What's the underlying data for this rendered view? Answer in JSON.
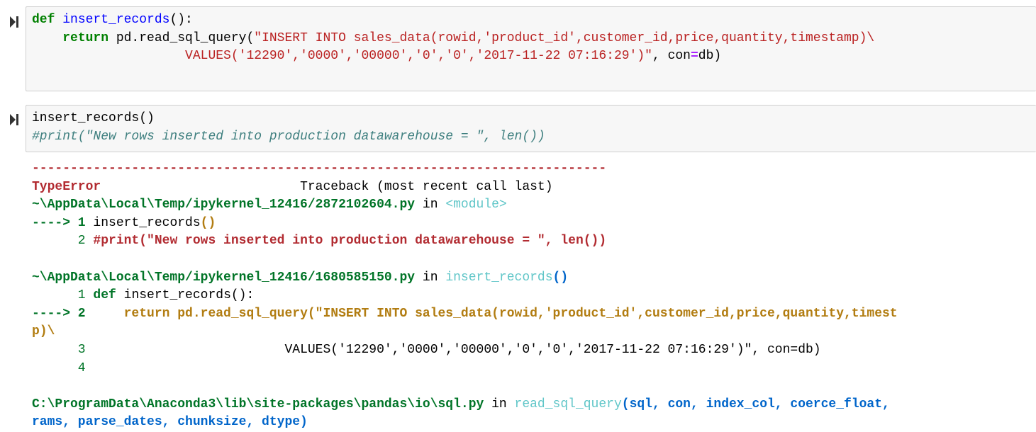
{
  "cell1": {
    "lines": [
      [
        "def",
        " ",
        "insert_records",
        "():"
      ],
      [
        "    ",
        "return",
        " pd.read_sql_query(",
        "\"INSERT INTO sales_data(rowid,'product_id',customer_id,price,quantity,timestamp)\\"
      ],
      [
        "                    ",
        "VALUES('12290','0000','00000','0','0','2017-11-22 07:16:29')\"",
        ", con",
        "=",
        "db)"
      ]
    ]
  },
  "cell2": {
    "line1": "insert_records()",
    "line2": "#print(\"New rows inserted into production datawarehouse = \", len())"
  },
  "traceback": {
    "dashes": "---------------------------------------------------------------------------",
    "error_type": "TypeError",
    "header_right": "                          Traceback (most recent call last)",
    "frame1_path": "~\\AppData\\Local\\Temp/ipykernel_12416/2872102604.py",
    "frame1_in": " in ",
    "frame1_func": "<module>",
    "f1_l1_arrow": "----> 1",
    "f1_l1_code": " insert_records",
    "f1_l1_paren": "()",
    "f1_l2_num": "      2",
    "f1_l2_code": " #print(\"New rows inserted into production datawarehouse = \", len())",
    "frame2_path": "~\\AppData\\Local\\Temp/ipykernel_12416/1680585150.py",
    "frame2_in": " in ",
    "frame2_func": "insert_records",
    "frame2_paren": "()",
    "f2_l1_num": "      1",
    "f2_l1_kw": " def",
    "f2_l1_rest": " insert_records():",
    "f2_l2_arrow": "----> 2",
    "f2_l2_code": "     return pd.read_sql_query(\"INSERT INTO sales_data(rowid,'product_id',customer_id,price,quantity,timest",
    "f2_l2_wrap": "p)\\",
    "f2_l3_num": "      3",
    "f2_l3_code": "                          VALUES('12290','0000','00000','0','0','2017-11-22 07:16:29')\", con=db)",
    "f2_l4_num": "      4",
    "frame3_path": "C:\\ProgramData\\Anaconda3\\lib\\site-packages\\pandas\\io\\sql.py",
    "frame3_in": " in ",
    "frame3_func": "read_sql_query",
    "frame3_args": "(sql, con, index_col, coerce_float,",
    "frame3_args2": "rams, parse_dates, chunksize, dtype)"
  }
}
